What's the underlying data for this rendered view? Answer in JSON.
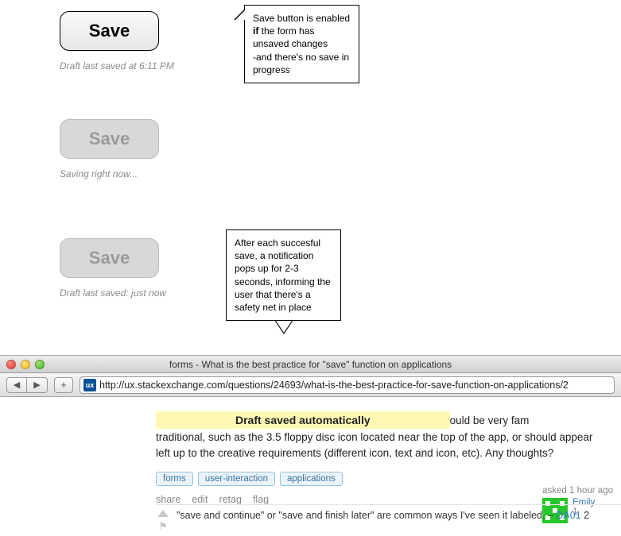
{
  "cards": {
    "enabled": {
      "label": "Save",
      "status": "Draft last saved at 6:11 PM"
    },
    "saving": {
      "label": "Save",
      "status": "Saving right now..."
    },
    "saved": {
      "label": "Save",
      "status": "Draft last saved: just now"
    }
  },
  "callouts": {
    "top": {
      "line1": "Save button is enabled ",
      "bold": "if",
      "line2": "  the form has unsaved changes",
      "line3": " -and there's no save in progress"
    },
    "bottom": "After each succesful save, a notification pops up for 2-3 seconds, informing the user that there's a safety net in place"
  },
  "browser": {
    "title": "forms - What is the best practice for \"save\" function on applications",
    "url": "http://ux.stackexchange.com/questions/24693/what-is-the-best-practice-for-save-function-on-applications/2",
    "favicon_text": "ux"
  },
  "page": {
    "banner": "Draft saved automatically",
    "body_tail1": "ould be very fam",
    "body_line2": "traditional, such as the 3.5 floppy disc icon located near the top of the app, or should appear",
    "body_line3": "left up to the creative requirements (different icon, text and icon, etc). Any thoughts?",
    "tags": [
      "forms",
      "user-interaction",
      "applications"
    ],
    "menu": [
      "share",
      "edit",
      "retag",
      "flag"
    ],
    "user": {
      "asked": "asked 1 hour ago",
      "name": "Emily",
      "rep": "1"
    },
    "comment": {
      "text": "\"save and continue\" or \"save and finish later\" are common ways I've seen it labeled. – ",
      "author": "DA01",
      "time_tail": " 2"
    }
  }
}
